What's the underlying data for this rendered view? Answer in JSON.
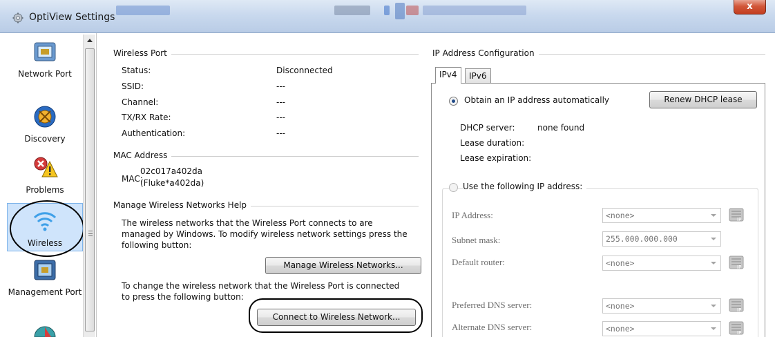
{
  "window": {
    "title": "OptiView Settings",
    "close_glyph": "x"
  },
  "sidebar": {
    "items": [
      {
        "label": "Network Port",
        "icon": "network-port-icon"
      },
      {
        "label": "Discovery",
        "icon": "discovery-icon"
      },
      {
        "label": "Problems",
        "icon": "problems-icon"
      },
      {
        "label": "Wireless",
        "icon": "wireless-icon"
      },
      {
        "label": "Management Port",
        "icon": "management-port-icon"
      }
    ]
  },
  "wireless_port": {
    "title": "Wireless Port",
    "rows": [
      {
        "label": "Status:",
        "value": "Disconnected"
      },
      {
        "label": "SSID:",
        "value": "---"
      },
      {
        "label": "Channel:",
        "value": "---"
      },
      {
        "label": "TX/RX Rate:",
        "value": "---"
      },
      {
        "label": "Authentication:",
        "value": "---"
      }
    ]
  },
  "mac_address": {
    "title": "MAC Address",
    "label": "MAC:",
    "value_line1": "02c017a402da",
    "value_line2": "(Fluke*a402da)"
  },
  "manage_help": {
    "title": "Manage Wireless Networks Help",
    "text1_line1": "The wireless networks that the Wireless Port connects to are",
    "text1_line2": "managed by Windows. To modify wireless network settings press the",
    "text1_line3": "following button:",
    "manage_button": "Manage Wireless Networks...",
    "text2_line1": "To change the wireless network that the Wireless Port is connected",
    "text2_line2": "to press the following button:",
    "connect_button": "Connect to Wireless Network..."
  },
  "ip_config": {
    "title": "IP Address Configuration",
    "tabs": [
      "IPv4",
      "IPv6"
    ],
    "auto_label": "Obtain an IP address automatically",
    "renew_button": "Renew DHCP lease",
    "dhcp_server_label": "DHCP server:",
    "dhcp_server_value": "none found",
    "lease_duration_label": "Lease duration:",
    "lease_expiration_label": "Lease expiration:",
    "manual_label": "Use the following IP address:",
    "fields": [
      {
        "label": "IP Address:",
        "value": "<none>"
      },
      {
        "label": "Subnet mask:",
        "value": "255.000.000.000"
      },
      {
        "label": "Default router:",
        "value": "<none>"
      },
      {
        "label": "Preferred DNS server:",
        "value": "<none>"
      },
      {
        "label": "Alternate DNS server:",
        "value": "<none>"
      }
    ]
  }
}
